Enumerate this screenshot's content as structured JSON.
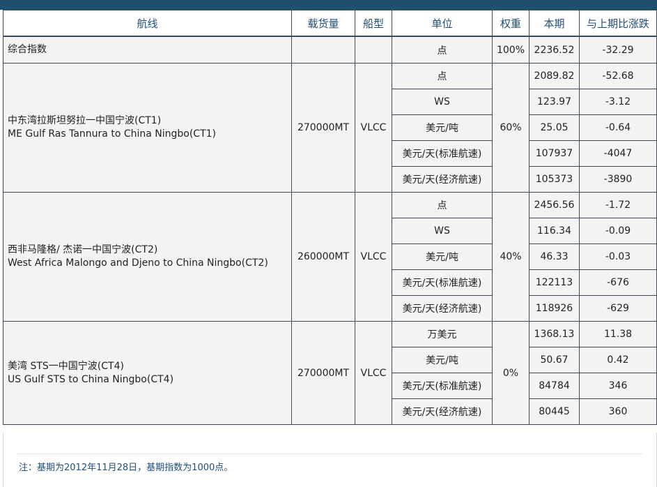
{
  "header": {
    "route": "航线",
    "cargo": "载货量",
    "ship": "船型",
    "unit": "单位",
    "weight": "权重",
    "current": "本期",
    "change": "与上期比涨跌"
  },
  "summary": {
    "name": "综合指数",
    "unit": "点",
    "weight": "100%",
    "current": "2236.52",
    "change": "-32.29"
  },
  "routes": [
    {
      "name_cn": "中东湾拉斯坦努拉一中国宁波(CT1)",
      "name_en": "ME Gulf Ras Tannura to China Ningbo(CT1)",
      "cargo": "270000MT",
      "ship": "VLCC",
      "weight": "60%",
      "rows": [
        {
          "unit": "点",
          "current": "2089.82",
          "change": "-52.68"
        },
        {
          "unit": "WS",
          "current": "123.97",
          "change": "-3.12"
        },
        {
          "unit": "美元/吨",
          "current": "25.05",
          "change": "-0.64"
        },
        {
          "unit": "美元/天(标准航速)",
          "current": "107937",
          "change": "-4047"
        },
        {
          "unit": "美元/天(经济航速)",
          "current": "105373",
          "change": "-3890"
        }
      ]
    },
    {
      "name_cn": "西非马隆格/ 杰诺一中国宁波(CT2)",
      "name_en": "West Africa Malongo and Djeno to China Ningbo(CT2)",
      "cargo": "260000MT",
      "ship": "VLCC",
      "weight": "40%",
      "rows": [
        {
          "unit": "点",
          "current": "2456.56",
          "change": "-1.72"
        },
        {
          "unit": "WS",
          "current": "116.34",
          "change": "-0.09"
        },
        {
          "unit": "美元/吨",
          "current": "46.33",
          "change": "-0.03"
        },
        {
          "unit": "美元/天(标准航速)",
          "current": "122113",
          "change": "-676"
        },
        {
          "unit": "美元/天(经济航速)",
          "current": "118926",
          "change": "-629"
        }
      ]
    },
    {
      "name_cn": "美湾 STS一中国宁波(CT4)",
      "name_en": "US Gulf STS to China Ningbo(CT4)",
      "cargo": "270000MT",
      "ship": "VLCC",
      "weight": "0%",
      "rows": [
        {
          "unit": "万美元",
          "current": "1368.13",
          "change": "11.38"
        },
        {
          "unit": "美元/吨",
          "current": "50.67",
          "change": "0.42"
        },
        {
          "unit": "美元/天(标准航速)",
          "current": "84784",
          "change": "346"
        },
        {
          "unit": "美元/天(经济航速)",
          "current": "80445",
          "change": "360"
        }
      ]
    }
  ],
  "note": "注：基期为2012年11月28日，基期指数为1000点。"
}
